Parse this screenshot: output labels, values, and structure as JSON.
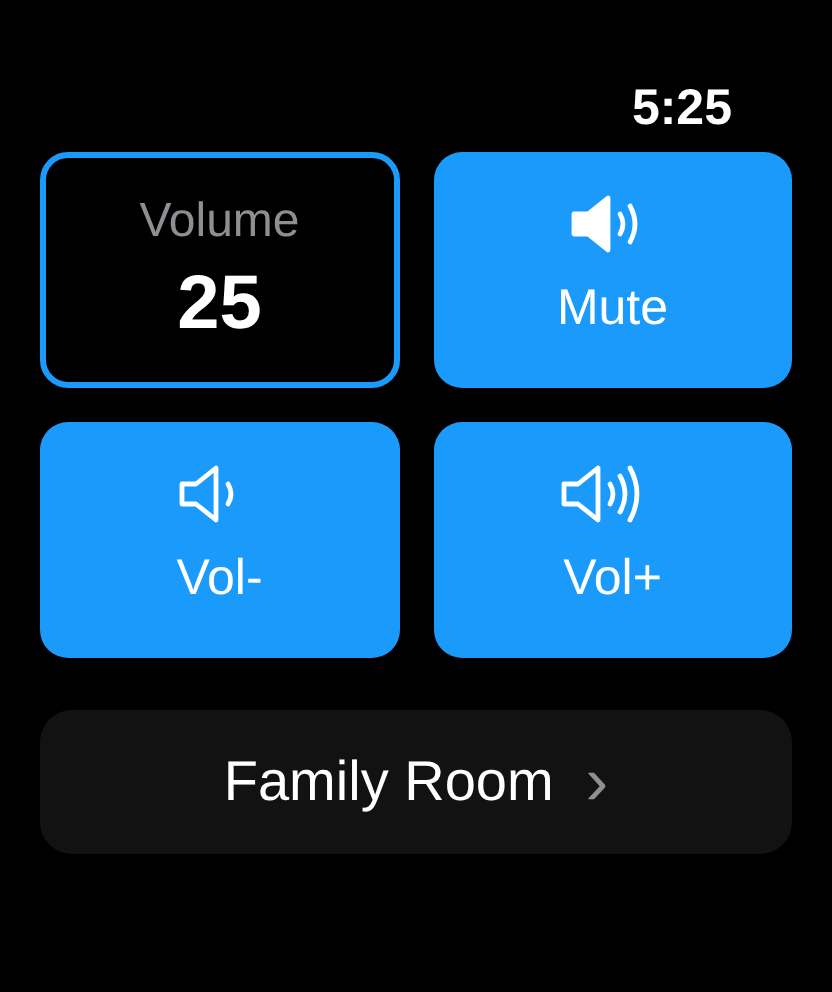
{
  "status_bar": {
    "time": "5:25"
  },
  "volume": {
    "label": "Volume",
    "value": "25",
    "focused": true
  },
  "buttons": [
    {
      "kind": "mute",
      "label": "Mute"
    },
    {
      "kind": "down",
      "label": "Vol-"
    },
    {
      "kind": "up",
      "label": "Vol+"
    }
  ],
  "room": {
    "label": "Family Room",
    "chevron": "›"
  }
}
